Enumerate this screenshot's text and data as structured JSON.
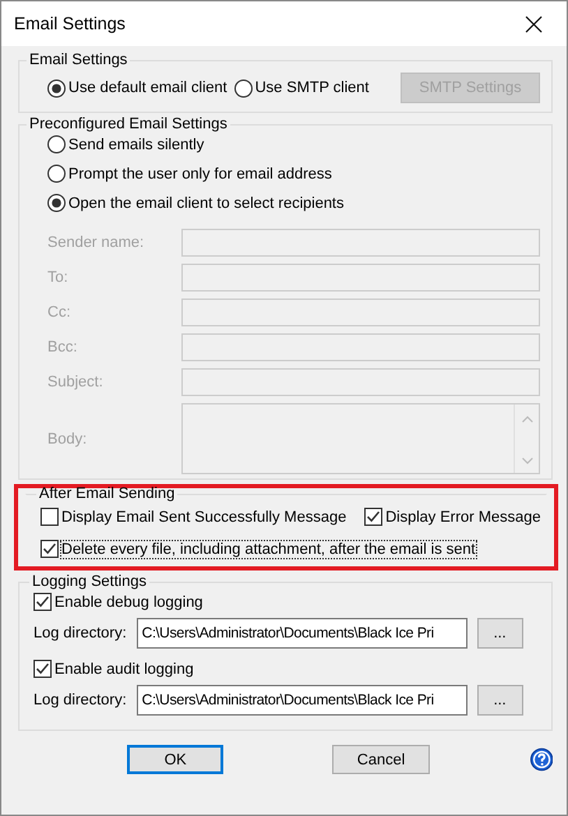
{
  "window": {
    "title": "Email Settings"
  },
  "email_settings": {
    "title": "Email Settings",
    "options": [
      {
        "label": "Use default email client",
        "selected": true
      },
      {
        "label": "Use SMTP client",
        "selected": false
      }
    ],
    "smtp_button": {
      "label": "SMTP Settings",
      "disabled": true
    }
  },
  "preconfigured": {
    "title": "Preconfigured Email Settings",
    "options": [
      {
        "label": "Send emails silently",
        "selected": false
      },
      {
        "label": "Prompt the user only for email address",
        "selected": false
      },
      {
        "label": "Open the email client to select recipients",
        "selected": true
      }
    ],
    "fields_disabled": true,
    "fields": [
      {
        "label": "Sender name:",
        "kind": "line"
      },
      {
        "label": "To:",
        "kind": "line"
      },
      {
        "label": "Cc:",
        "kind": "line"
      },
      {
        "label": "Bcc:",
        "kind": "line"
      },
      {
        "label": "Subject:",
        "kind": "line"
      },
      {
        "label": "Body:",
        "kind": "multiline"
      }
    ]
  },
  "after_sending": {
    "title": "After Email Sending",
    "highlighted": true,
    "options": [
      {
        "label": "Display Email Sent Successfully Message",
        "checked": false,
        "focused": false
      },
      {
        "label": "Display Error Message",
        "checked": true,
        "focused": false
      },
      {
        "label": "Delete every file, including attachment, after the email is sent",
        "checked": true,
        "focused": true
      }
    ]
  },
  "logging": {
    "title": "Logging Settings",
    "entries": [
      {
        "label": "Enable debug logging",
        "checked": true,
        "dir_label": "Log directory:",
        "dir_value": "C:\\Users\\Administrator\\Documents\\Black Ice Pri",
        "browse": "..."
      },
      {
        "label": "Enable audit logging",
        "checked": true,
        "dir_label": "Log directory:",
        "dir_value": "C:\\Users\\Administrator\\Documents\\Black Ice Pri",
        "browse": "..."
      }
    ]
  },
  "buttons": [
    {
      "label": "OK",
      "default": true
    },
    {
      "label": "Cancel",
      "default": false
    }
  ]
}
